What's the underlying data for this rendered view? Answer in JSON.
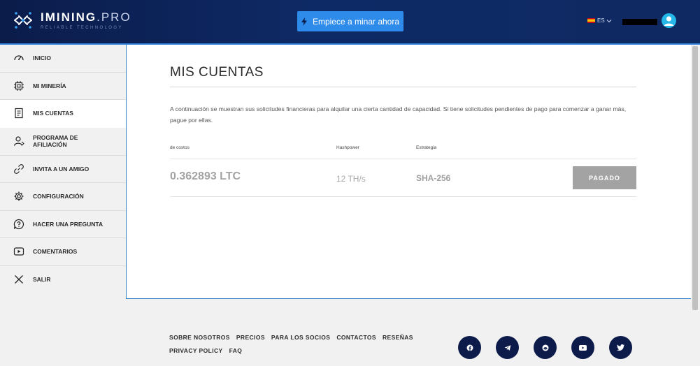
{
  "header": {
    "logo_title": "IMINING",
    "logo_title_suffix": ".PRO",
    "logo_subtitle": "RELIABLE TECHNOLOGY",
    "cta_label": "Empiece a minar ahora",
    "language": "ES",
    "language_chevron": "chevron-down-icon",
    "avatar_icon": "user-avatar-icon"
  },
  "sidebar": {
    "items": [
      {
        "label": "INICIO",
        "icon": "speedometer-icon"
      },
      {
        "label": "MI MINERÍA",
        "icon": "chip-icon"
      },
      {
        "label": "MIS CUENTAS",
        "icon": "invoice-icon",
        "active": true
      },
      {
        "label": "PROGRAMA DE",
        "label2": "AFILIACIÓN",
        "icon": "user-share-icon"
      },
      {
        "label": "INVITA A UN AMIGO",
        "icon": "link-icon"
      },
      {
        "label": "CONFIGURACIÓN",
        "icon": "gear-icon"
      },
      {
        "label": "HACER UNA PREGUNTA",
        "icon": "question-icon"
      },
      {
        "label": "COMENTARIOS",
        "icon": "play-icon"
      },
      {
        "label": "SALIR",
        "icon": "close-icon"
      }
    ]
  },
  "main": {
    "title": "MIS CUENTAS",
    "description": "A continuación se muestran sus solicitudes financieras para alquilar una cierta cantidad de capacidad. Si tiene solicitudes pendientes de pago para comenzar a ganar más, pague por ellas.",
    "table": {
      "headers": [
        "de costos",
        "Hashpower",
        "Estrategia"
      ],
      "rows": [
        {
          "cost": "0.362893 LTC",
          "hashpower": "12 TH/s",
          "strategy": "SHA-256",
          "status": "PAGADO"
        }
      ]
    }
  },
  "footer": {
    "links_row1": [
      "SOBRE NOSOTROS",
      "PRECIOS",
      "PARA LOS SOCIOS",
      "CONTACTOS",
      "RESEÑAS"
    ],
    "links_row2": [
      "PRIVACY POLICY",
      "FAQ"
    ],
    "socials": [
      "facebook-icon",
      "telegram-icon",
      "reddit-icon",
      "youtube-icon",
      "twitter-icon"
    ]
  },
  "colors": {
    "header_bg": "#0e2a66",
    "cta": "#2f8bea",
    "status_badge": "#a3a3a3",
    "social_bg": "#0d1b4b",
    "avatar": "#24b7e8"
  }
}
